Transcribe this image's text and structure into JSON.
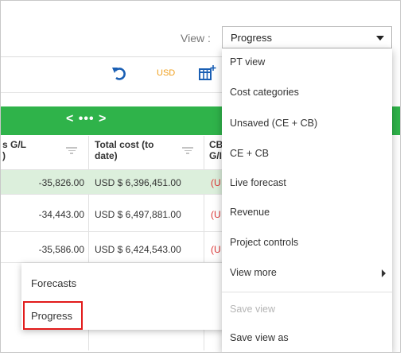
{
  "view": {
    "label": "View :",
    "selected": "Progress"
  },
  "toolbar": {
    "currency": "USD",
    "undo_icon": "undo-icon",
    "columns_icon": "add-column-icon"
  },
  "grid": {
    "pager": "< ••• >",
    "columns": [
      {
        "label_line1": "s G/L",
        "label_line2": ")"
      },
      {
        "label_line1": "Total cost (to",
        "label_line2": "date)"
      },
      {
        "label_line1": "CB",
        "label_line2": "G/I"
      }
    ],
    "rows": [
      {
        "gl": "-35,826.00",
        "total": "USD $ 6,396,451.00",
        "cb": "(U"
      },
      {
        "gl": "-34,443.00",
        "total": "USD $ 6,497,881.00",
        "cb": "(U"
      },
      {
        "gl": "-35,586.00",
        "total": "USD $ 6,424,543.00",
        "cb": "(U"
      }
    ]
  },
  "sub_menu": {
    "items": [
      "Forecasts",
      "Progress"
    ]
  },
  "dropdown": {
    "items": [
      "PT view",
      "Cost categories",
      "Unsaved (CE + CB)",
      "CE + CB",
      "Live forecast",
      "Revenue",
      "Project controls",
      "View more"
    ],
    "save_view": "Save view",
    "save_view_as": "Save view as"
  }
}
